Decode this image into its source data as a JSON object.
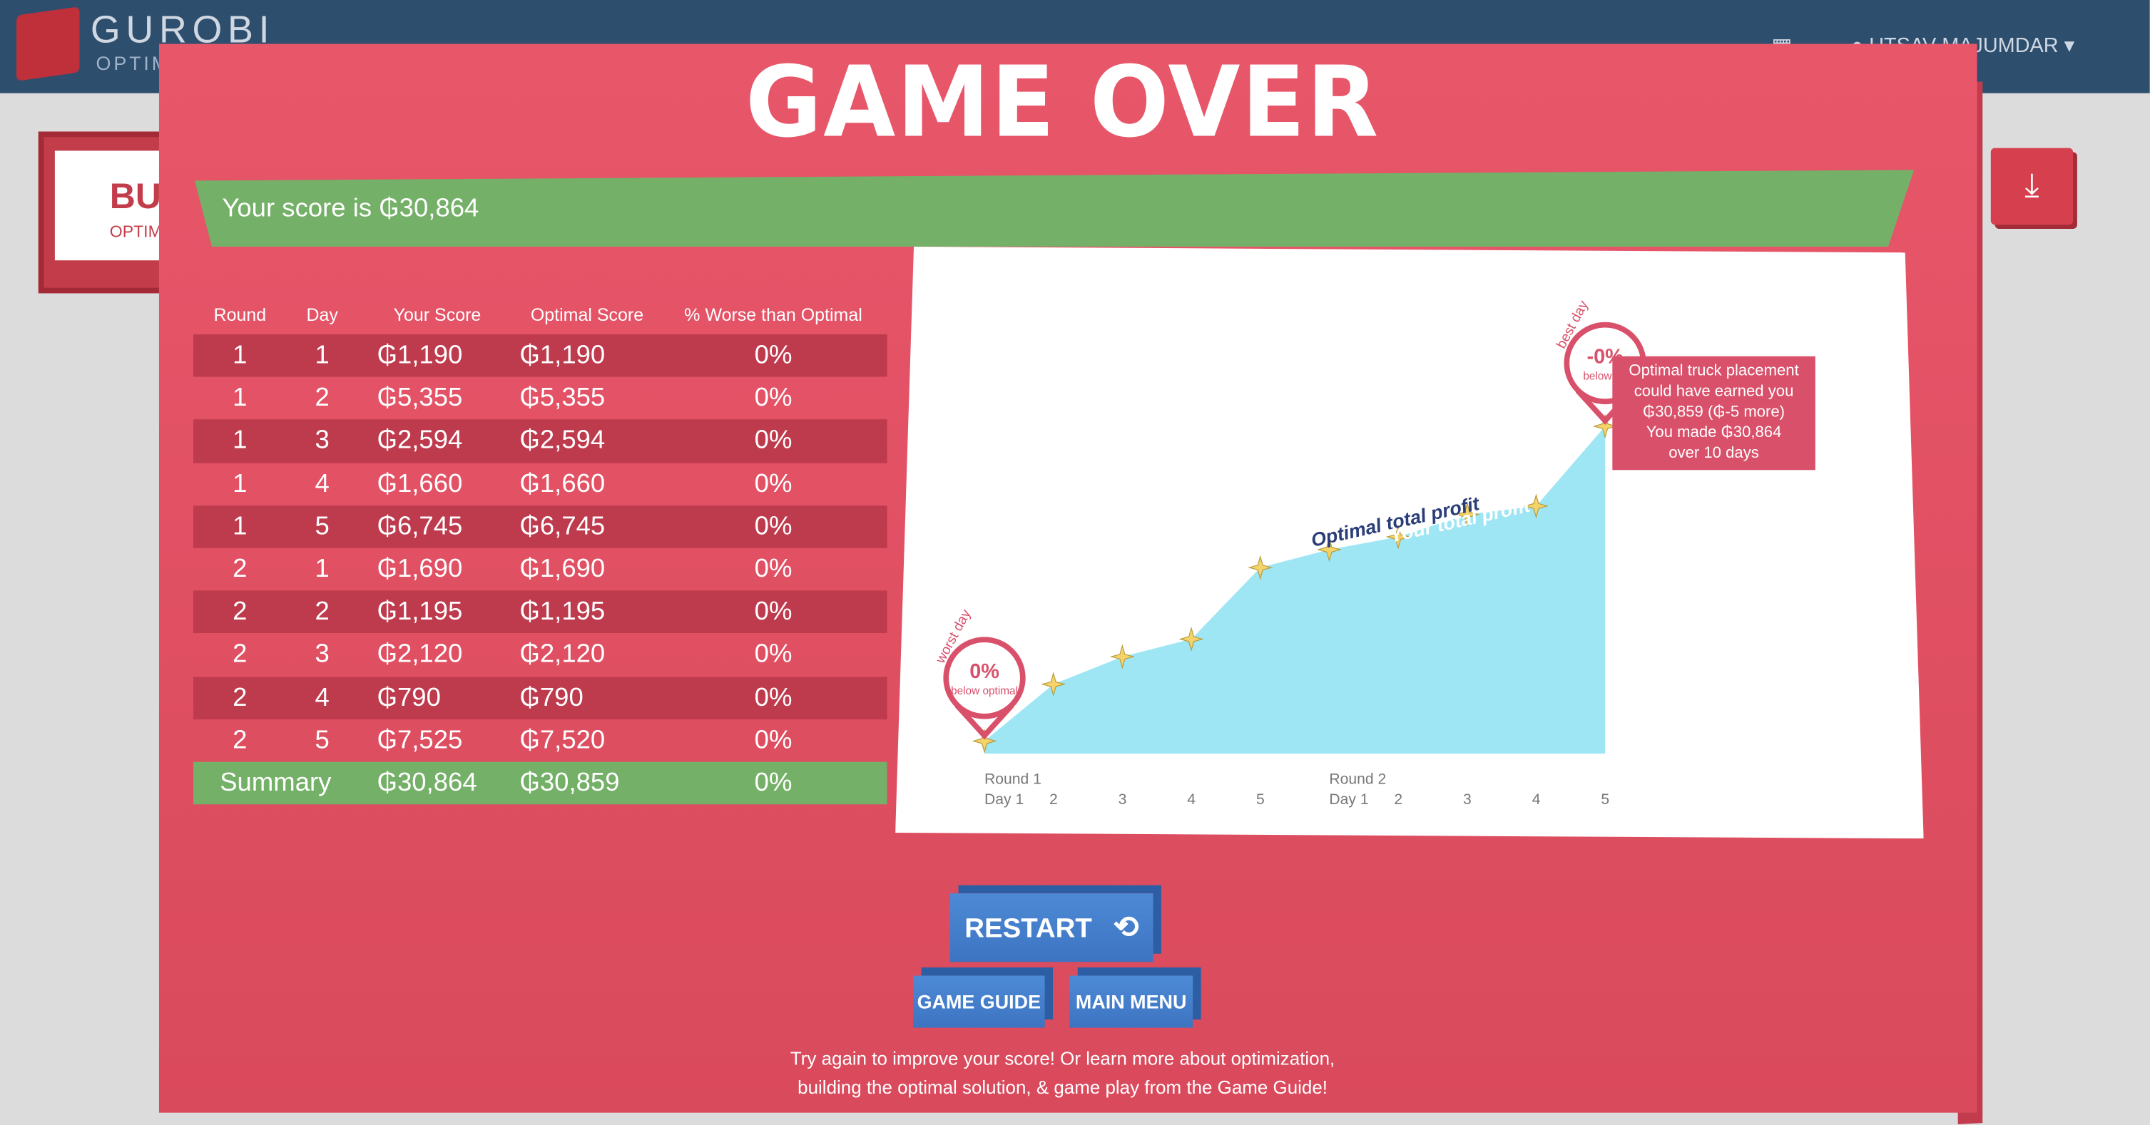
{
  "background": {
    "brand": "GUROBI",
    "brand_sub": "OPTIM",
    "user_name": "UTSAV MAJUMDAR",
    "card_text": "BU",
    "card_sub": "OPTIM"
  },
  "modal": {
    "title": "GAME OVER",
    "score_text": "Your score is ₲30,864"
  },
  "table": {
    "headers": [
      "Round",
      "Day",
      "Your Score",
      "Optimal Score",
      "% Worse than Optimal"
    ],
    "rows": [
      [
        "1",
        "1",
        "₲1,190",
        "₲1,190",
        "0%"
      ],
      [
        "1",
        "2",
        "₲5,355",
        "₲5,355",
        "0%"
      ],
      [
        "1",
        "3",
        "₲2,594",
        "₲2,594",
        "0%"
      ],
      [
        "1",
        "4",
        "₲1,660",
        "₲1,660",
        "0%"
      ],
      [
        "1",
        "5",
        "₲6,745",
        "₲6,745",
        "0%"
      ],
      [
        "2",
        "1",
        "₲1,690",
        "₲1,690",
        "0%"
      ],
      [
        "2",
        "2",
        "₲1,195",
        "₲1,195",
        "0%"
      ],
      [
        "2",
        "3",
        "₲2,120",
        "₲2,120",
        "0%"
      ],
      [
        "2",
        "4",
        "₲790",
        "₲790",
        "0%"
      ],
      [
        "2",
        "5",
        "₲7,525",
        "₲7,520",
        "0%"
      ]
    ],
    "summary": [
      "Summary",
      "₲30,864",
      "₲30,859",
      "0%"
    ]
  },
  "chart_data": {
    "type": "area",
    "x_labels": [
      "Round 1 Day 1",
      "2",
      "3",
      "4",
      "5",
      "Round 2 Day 1",
      "2",
      "3",
      "4",
      "5"
    ],
    "series": [
      {
        "name": "Optimal total profit",
        "values": [
          1190,
          6545,
          9139,
          10799,
          17544,
          19234,
          20429,
          22549,
          23339,
          30859
        ]
      },
      {
        "name": "Your total profit",
        "values": [
          1190,
          6545,
          9139,
          10799,
          17544,
          19234,
          20429,
          22549,
          23339,
          30864
        ]
      }
    ],
    "worst_day": {
      "label": "worst day",
      "value": "0%",
      "sub": "below optimal"
    },
    "best_day": {
      "label": "best day",
      "value": "-0%",
      "sub": "below op"
    },
    "tooltip": [
      "Optimal truck placement",
      "could have earned you",
      "₲30,859 (₲-5 more)",
      "You made ₲30,864",
      "over 10 days"
    ],
    "colors": {
      "area": "#9fe6f4",
      "marker": "#f3d36a",
      "optimal_label": "#2a3d78",
      "your_label": "#ffffff",
      "pin": "#d9506a"
    }
  },
  "buttons": {
    "restart": "RESTART",
    "restart_icon": "restart-arrow-icon",
    "guide": "GAME GUIDE",
    "menu": "MAIN MENU"
  },
  "footer": {
    "line1": "Try again to improve your score! Or learn more about optimization,",
    "line2": "building the optimal solution, & game play from the Game Guide!"
  }
}
